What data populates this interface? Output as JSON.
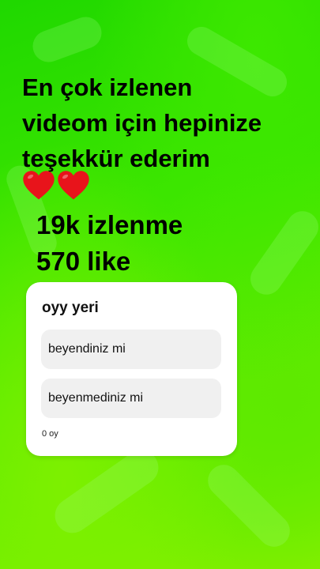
{
  "headline": {
    "line1": "En çok izlenen",
    "line2": "videom için hepinize",
    "line3": "teşekkür ederim"
  },
  "hearts": {
    "icon": "red-heart-icon",
    "count": 2,
    "color": "#e8141b"
  },
  "stats": {
    "views": "19k izlenme",
    "likes": "570 like"
  },
  "poll": {
    "title": "oyy yeri",
    "options": [
      {
        "label": "beyendiniz mi"
      },
      {
        "label": "beyenmediniz mi"
      }
    ],
    "votes": "0 oy"
  },
  "colors": {
    "background": "#2fe000",
    "card": "#ffffff",
    "option_bg": "#f0f0f0",
    "text": "#000000"
  }
}
